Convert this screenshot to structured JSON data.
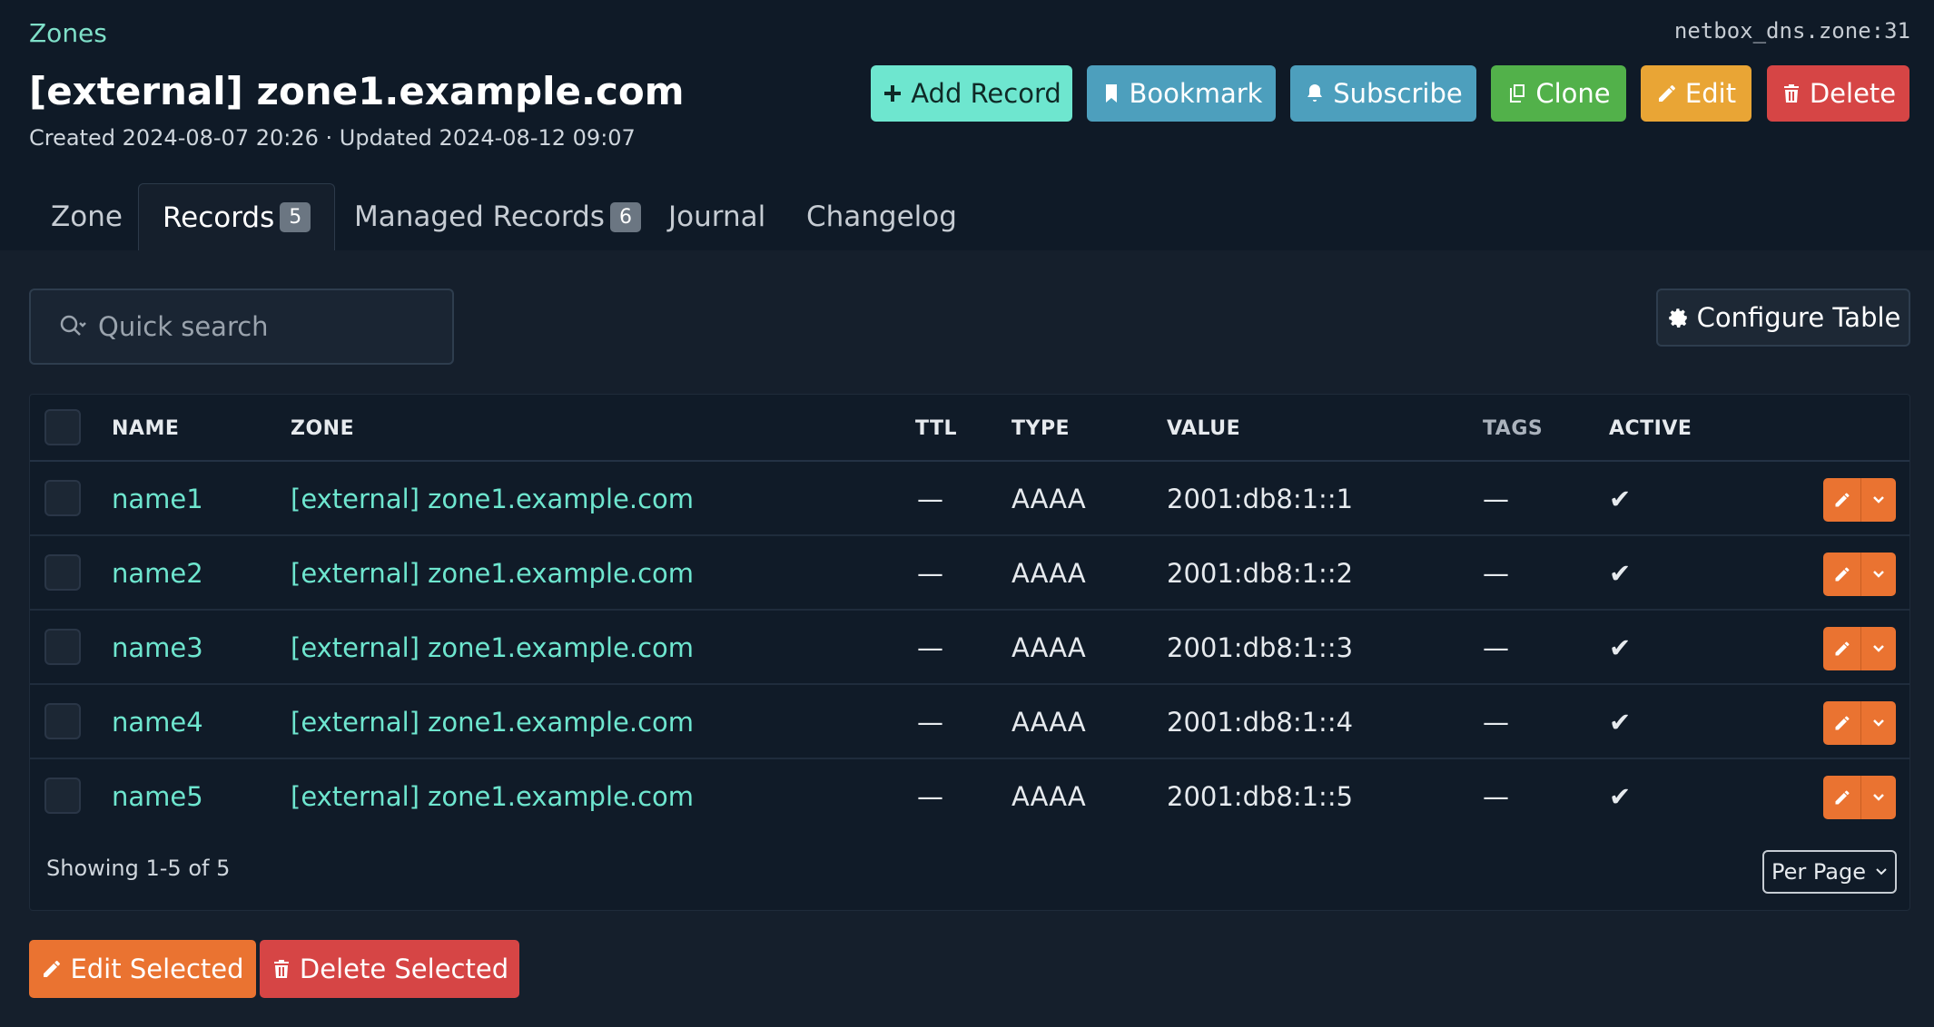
{
  "breadcrumb": "Zones",
  "object_id": "netbox_dns.zone:31",
  "title": "[external] zone1.example.com",
  "meta": "Created 2024-08-07 20:26 · Updated 2024-08-12 09:07",
  "actions": {
    "add_record": "Add Record",
    "bookmark": "Bookmark",
    "subscribe": "Subscribe",
    "clone": "Clone",
    "edit": "Edit",
    "delete": "Delete"
  },
  "tabs": [
    {
      "label": "Zone"
    },
    {
      "label": "Records",
      "count": "5",
      "active": true
    },
    {
      "label": "Managed Records",
      "count": "6"
    },
    {
      "label": "Journal"
    },
    {
      "label": "Changelog"
    }
  ],
  "search": {
    "placeholder": "Quick search"
  },
  "configure_table": "Configure Table",
  "table": {
    "columns": [
      "NAME",
      "ZONE",
      "TTL",
      "TYPE",
      "VALUE",
      "TAGS",
      "ACTIVE"
    ],
    "rows": [
      {
        "name": "name1",
        "zone": "[external] zone1.example.com",
        "ttl": "—",
        "type": "AAAA",
        "value": "2001:db8:1::1",
        "tags": "—",
        "active": "✔"
      },
      {
        "name": "name2",
        "zone": "[external] zone1.example.com",
        "ttl": "—",
        "type": "AAAA",
        "value": "2001:db8:1::2",
        "tags": "—",
        "active": "✔"
      },
      {
        "name": "name3",
        "zone": "[external] zone1.example.com",
        "ttl": "—",
        "type": "AAAA",
        "value": "2001:db8:1::3",
        "tags": "—",
        "active": "✔"
      },
      {
        "name": "name4",
        "zone": "[external] zone1.example.com",
        "ttl": "—",
        "type": "AAAA",
        "value": "2001:db8:1::4",
        "tags": "—",
        "active": "✔"
      },
      {
        "name": "name5",
        "zone": "[external] zone1.example.com",
        "ttl": "—",
        "type": "AAAA",
        "value": "2001:db8:1::5",
        "tags": "—",
        "active": "✔"
      }
    ]
  },
  "showing": "Showing 1-5 of 5",
  "per_page": "Per Page",
  "bulk": {
    "edit_selected": "Edit Selected",
    "delete_selected": "Delete Selected"
  },
  "colors": {
    "accent": "#6ee6cf",
    "info": "#4d9fbd",
    "success": "#52b14a",
    "warning": "#e9a535",
    "danger": "#d64545",
    "orange": "#ea7331"
  }
}
